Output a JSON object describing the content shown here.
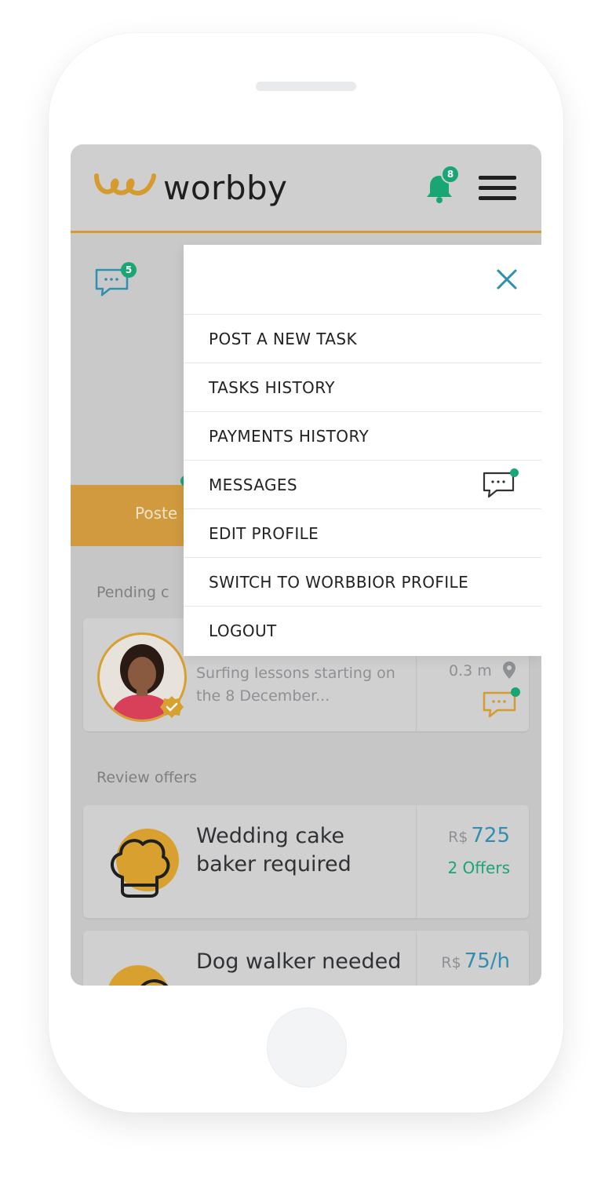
{
  "app": {
    "brand": "worbby",
    "brand_color": "#d69b2e",
    "accent_green": "#1aa575",
    "accent_blue": "#2f8fb0"
  },
  "header": {
    "notification_count": "8",
    "icons": [
      "worbby-logo-icon",
      "bell-icon",
      "hamburger-menu-icon"
    ]
  },
  "messages_indicator": {
    "count": "5"
  },
  "tabs": {
    "posted_label": "Poste"
  },
  "sections": {
    "pending_label": "Pending c",
    "review_label": "Review offers"
  },
  "pending_card": {
    "description": "Surfing lessons starting on the 8 December...",
    "distance": "0.3 m"
  },
  "tasks": [
    {
      "title": "Wedding cake baker required",
      "currency": "R$",
      "price": "725",
      "offers": "2 Offers",
      "icon": "chef-hat-icon"
    },
    {
      "title": "Dog walker needed",
      "currency": "R$",
      "price": "75/h",
      "offers": "",
      "icon": "dog-icon"
    }
  ],
  "menu": {
    "items": [
      {
        "label": "POST A NEW TASK"
      },
      {
        "label": "TASKS HISTORY"
      },
      {
        "label": "PAYMENTS HISTORY"
      },
      {
        "label": "MESSAGES",
        "has_new": true
      },
      {
        "label": "EDIT PROFILE"
      },
      {
        "label": "SWITCH TO WORBBIOR PROFILE"
      },
      {
        "label": "LOGOUT"
      }
    ]
  }
}
